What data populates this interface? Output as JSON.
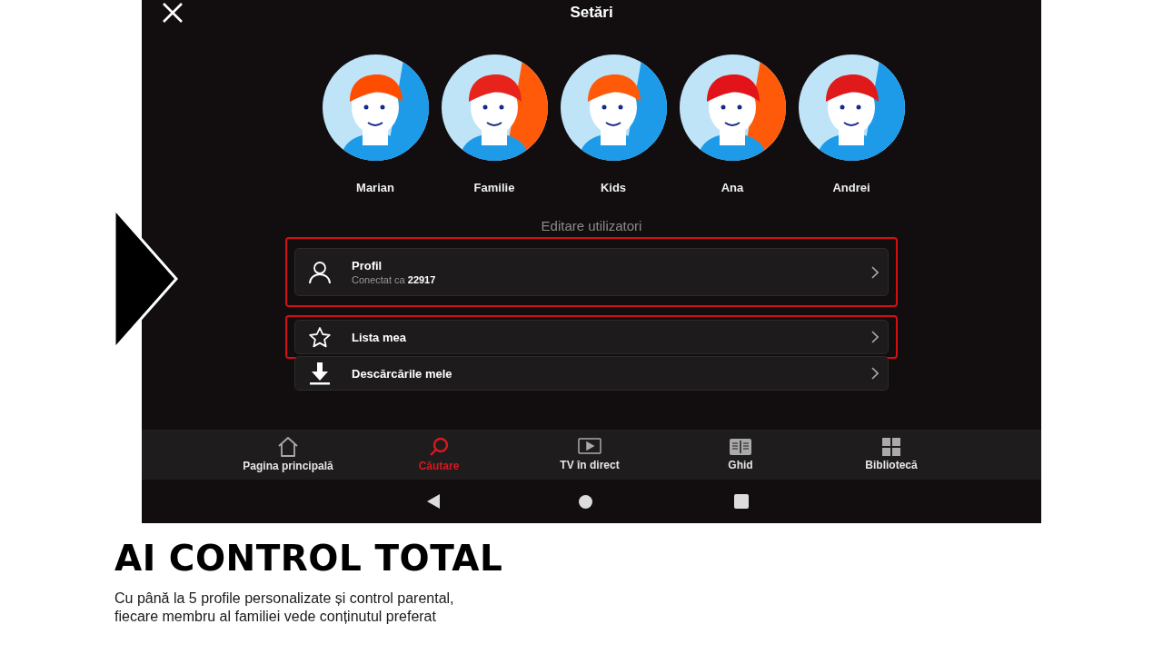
{
  "screen": {
    "title": "Setări",
    "profiles": [
      {
        "name": "Marian"
      },
      {
        "name": "Familie"
      },
      {
        "name": "Kids"
      },
      {
        "name": "Ana"
      },
      {
        "name": "Andrei"
      }
    ],
    "section_title": "Editare utilizatori",
    "menu": [
      {
        "kind": "person",
        "label": "Profil",
        "subtitle": "Conectat ca **22917**",
        "highlighted": true
      },
      {
        "kind": "star",
        "label": "Lista mea",
        "highlighted": true
      },
      {
        "kind": "download",
        "label": "Descărcările mele",
        "highlighted": false
      }
    ],
    "nav": [
      {
        "kind": "home",
        "label": "Pagina principală",
        "selected": false
      },
      {
        "kind": "search",
        "label": "Căutare",
        "selected": true
      },
      {
        "kind": "tv",
        "label": "TV în direct",
        "selected": false
      },
      {
        "kind": "guide",
        "label": "Ghid",
        "selected": false
      },
      {
        "kind": "library",
        "label": "Bibliotecă",
        "selected": false
      }
    ]
  },
  "caption": {
    "heading": "AI CONTROL TOTAL",
    "text": "Cu până la 5 profile personalizate și control parental, fiecare membru al familiei vede conținutul preferat"
  }
}
